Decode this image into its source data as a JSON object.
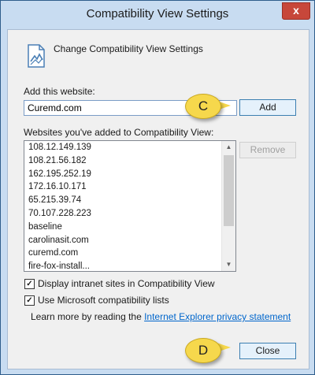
{
  "window": {
    "title": "Compatibility View Settings",
    "close_glyph": "x"
  },
  "header": {
    "text": "Change Compatibility View Settings",
    "icon": "compat-view-page-icon"
  },
  "add_section": {
    "label": "Add this website:",
    "input_value": "Curemd.com",
    "add_button": "Add"
  },
  "list_section": {
    "label": "Websites you've added to Compatibility View:",
    "items": [
      "108.12.149.139",
      "108.21.56.182",
      "162.195.252.19",
      "172.16.10.171",
      "65.215.39.74",
      "70.107.228.223",
      "baseline",
      "carolinasit.com",
      "curemd.com",
      "fire-fox-install..."
    ],
    "remove_button": "Remove"
  },
  "options": {
    "intranet": {
      "label": "Display intranet sites in Compatibility View",
      "checked": true
    },
    "ms_lists": {
      "label": "Use Microsoft compatibility lists",
      "checked": true
    }
  },
  "learn_more": {
    "prefix": "Learn more by reading the ",
    "link": "Internet Explorer privacy statement"
  },
  "footer": {
    "close_button": "Close"
  },
  "callouts": {
    "c": "C",
    "d": "D",
    "color": "#f6d84c"
  }
}
